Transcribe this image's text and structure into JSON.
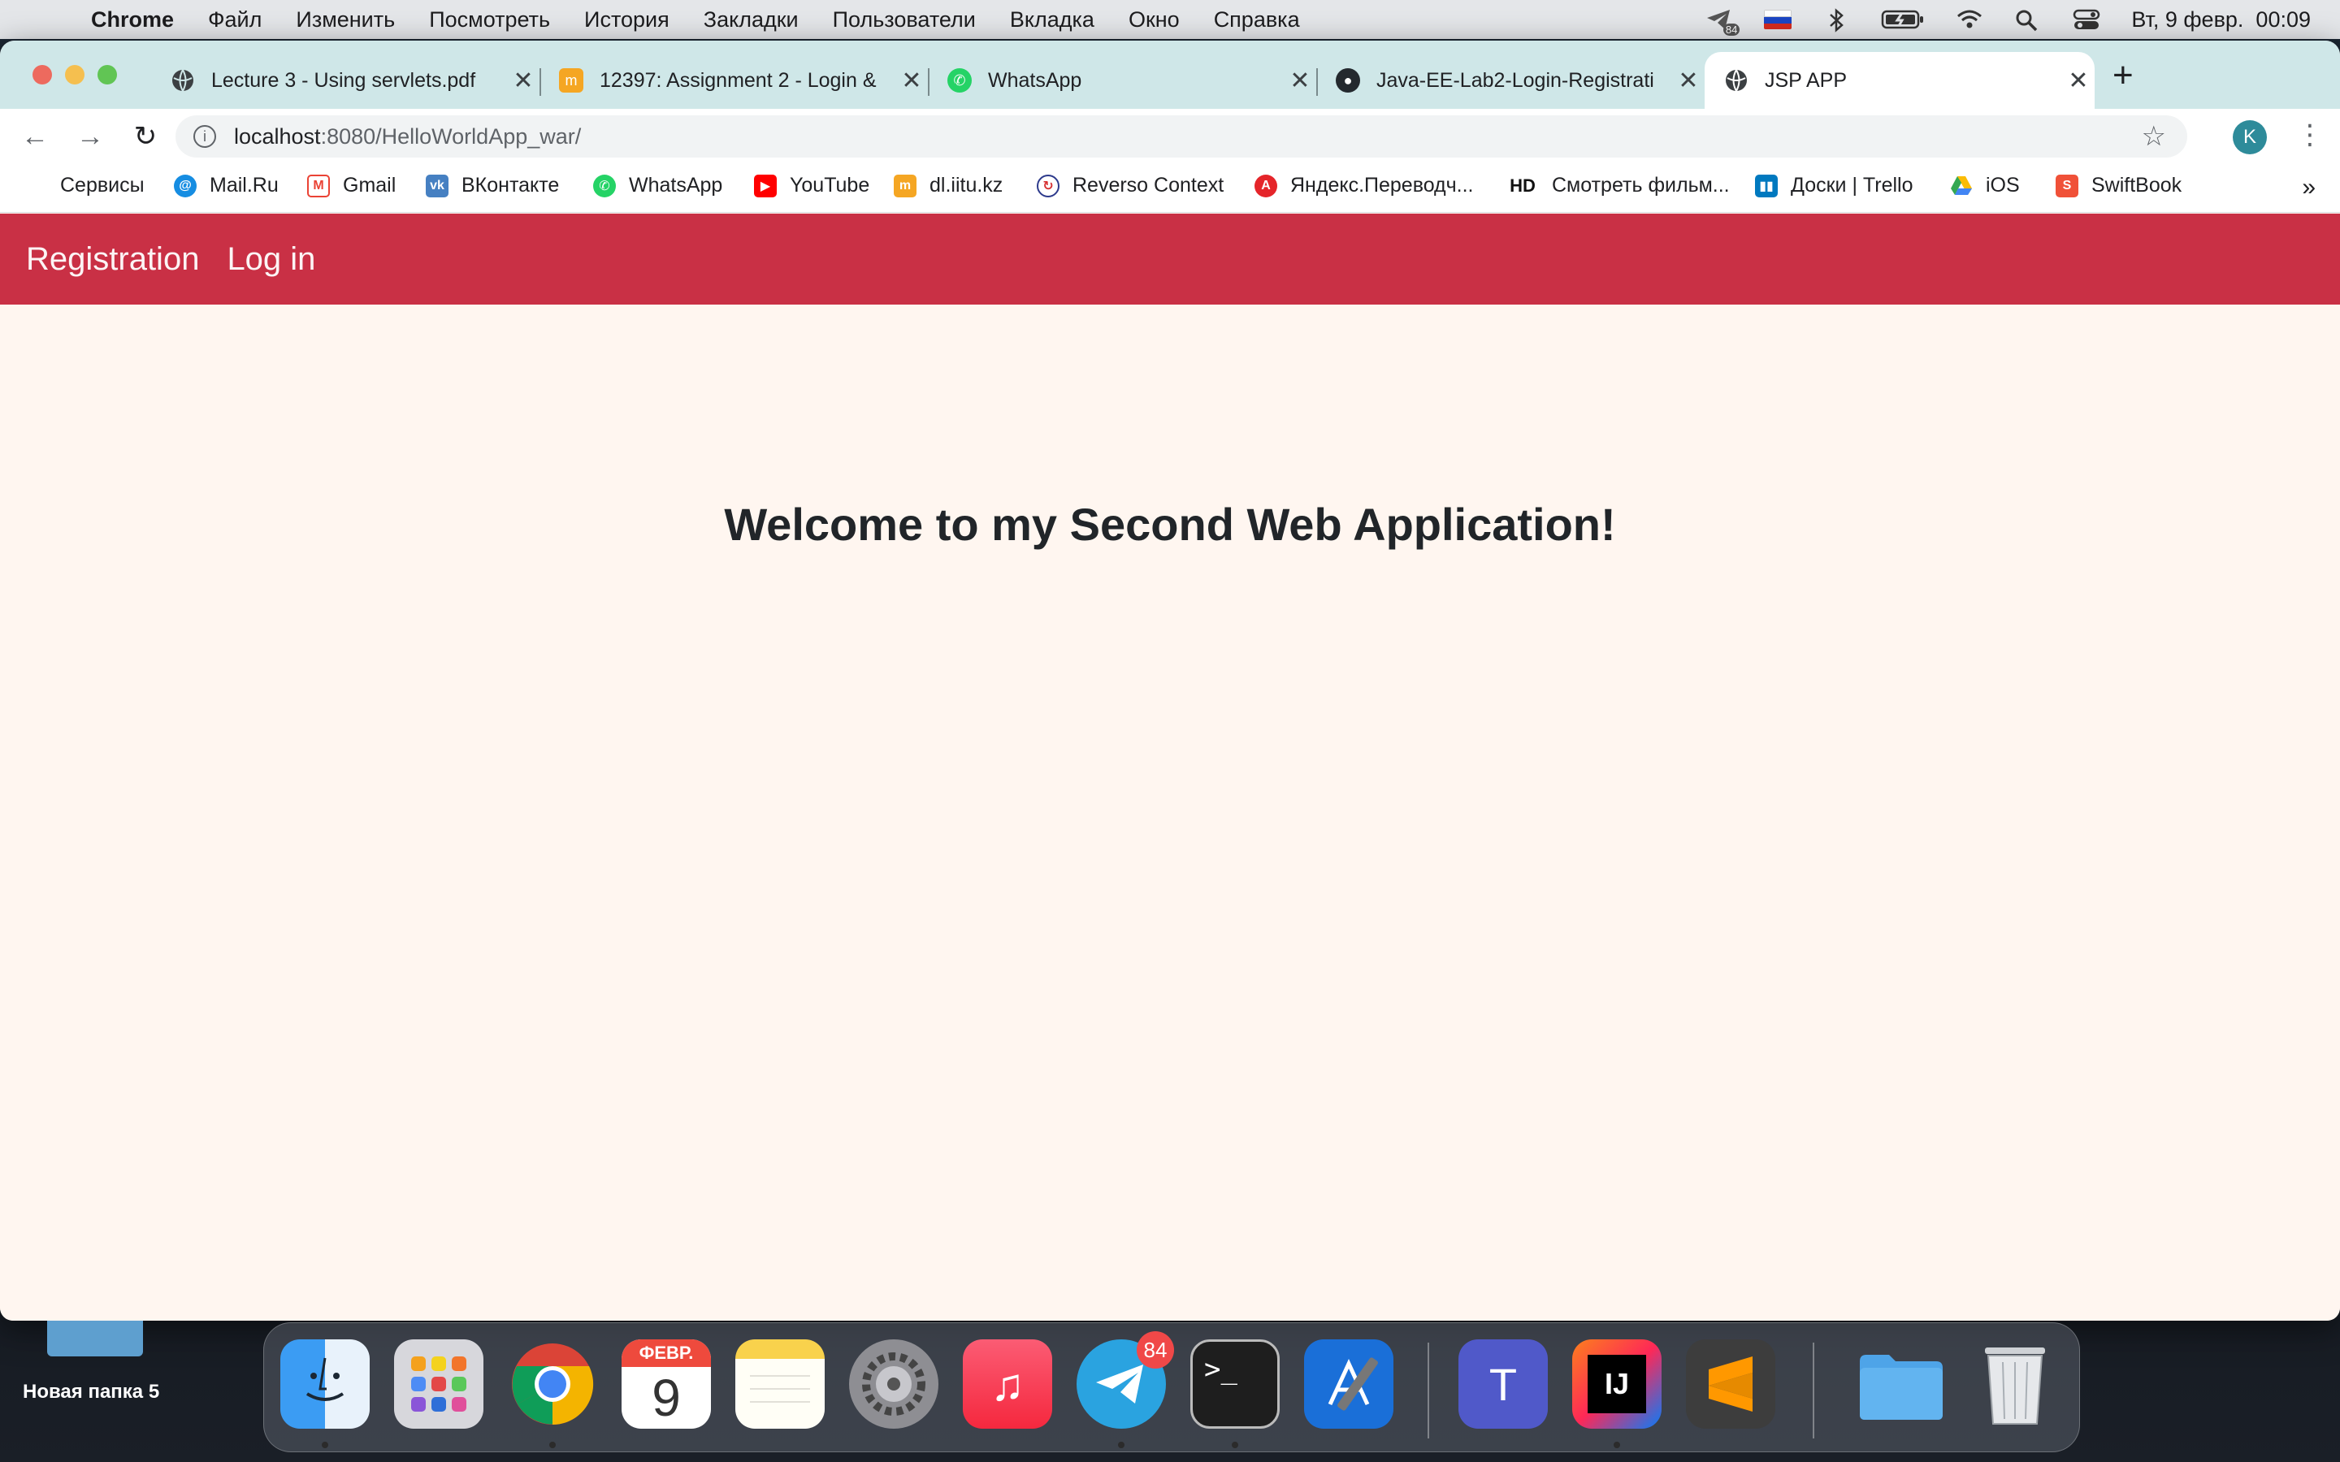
{
  "menubar": {
    "app_name": "Chrome",
    "items": [
      "Файл",
      "Изменить",
      "Посмотреть",
      "История",
      "Закладки",
      "Пользователи",
      "Вкладка",
      "Окно",
      "Справка"
    ],
    "telegram_badge": "84",
    "clock": "Вт, 9 февр.  00:09"
  },
  "tabs": [
    {
      "title": "Lecture 3 - Using servlets.pdf",
      "favicon": "globe-icon"
    },
    {
      "title": "12397: Assignment 2 - Login &",
      "favicon": "moodle-icon"
    },
    {
      "title": "WhatsApp",
      "favicon": "whatsapp-icon"
    },
    {
      "title": "Java-EE-Lab2-Login-Registrati",
      "favicon": "github-icon"
    },
    {
      "title": "JSP APP",
      "favicon": "globe-icon",
      "active": true
    }
  ],
  "address": {
    "host": "localhost",
    "path": ":8080/HelloWorldApp_war/"
  },
  "profile_initial": "K",
  "bookmarks": [
    {
      "label": "Сервисы",
      "icon": "apps-grid-icon"
    },
    {
      "label": "Mail.Ru",
      "icon": "mailru-icon"
    },
    {
      "label": "Gmail",
      "icon": "gmail-icon"
    },
    {
      "label": "ВКонтакте",
      "icon": "vk-icon"
    },
    {
      "label": "WhatsApp",
      "icon": "whatsapp-icon"
    },
    {
      "label": "YouTube",
      "icon": "youtube-icon"
    },
    {
      "label": "dl.iitu.kz",
      "icon": "moodle-icon"
    },
    {
      "label": "Reverso Context",
      "icon": "reverso-icon"
    },
    {
      "label": "Яндекс.Переводч...",
      "icon": "yandex-translate-icon"
    },
    {
      "label": "Смотреть фильм...",
      "icon": "hd-icon",
      "icon_text": "HD"
    },
    {
      "label": "Доски | Trello",
      "icon": "trello-icon"
    },
    {
      "label": "iOS",
      "icon": "google-drive-icon"
    },
    {
      "label": "SwiftBook",
      "icon": "swiftbook-icon",
      "icon_text": "S"
    }
  ],
  "site": {
    "nav": [
      "Registration",
      "Log in"
    ],
    "heading": "Welcome to my Second Web Application!",
    "navbar_color": "#c93045",
    "background_color": "#fff6f0"
  },
  "desktop": {
    "folder_label": "Новая папка 5"
  },
  "dock": {
    "calendar_month": "ФЕВР.",
    "calendar_day": "9",
    "telegram_badge": "84",
    "apps": [
      "finder-icon",
      "launchpad-icon",
      "chrome-icon",
      "calendar-icon",
      "notes-icon",
      "system-preferences-icon",
      "music-icon",
      "telegram-icon",
      "terminal-icon",
      "xcode-icon",
      "teams-icon",
      "intellij-icon",
      "sublime-icon",
      "folder-icon",
      "trash-icon"
    ],
    "terminal_text": ">_",
    "teams_text": "T",
    "intellij_text": "IJ"
  }
}
